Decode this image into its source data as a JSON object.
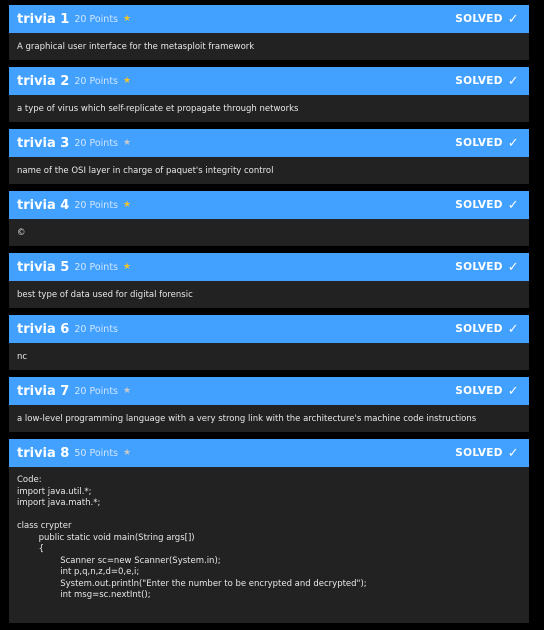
{
  "solved_label": "SOLVED",
  "colors": {
    "header": "#42a1ff",
    "body": "#222222",
    "star_gold": "#f2c230",
    "star_grey": "#c8c8c8"
  },
  "challenges": [
    {
      "title": "trivia 1",
      "points": "20 Points",
      "star": "gold",
      "description": "A graphical user interface for the metasploit framework"
    },
    {
      "title": "trivia 2",
      "points": "20 Points",
      "star": "gold",
      "description": "a type of virus which self-replicate et propagate through networks"
    },
    {
      "title": "trivia 3",
      "points": "20 Points",
      "star": "grey",
      "description": "name of the OSI layer in charge of paquet's integrity control"
    },
    {
      "title": "trivia 4",
      "points": "20 Points",
      "star": "gold",
      "description": "©"
    },
    {
      "title": "trivia 5",
      "points": "20 Points",
      "star": "gold",
      "description": "best type of data used for digital forensic"
    },
    {
      "title": "trivia 6",
      "points": "20 Points",
      "star": "none",
      "description": "nc"
    },
    {
      "title": "trivia 7",
      "points": "20 Points",
      "star": "grey",
      "description": "a low-level programming language with a very strong link with the architecture's machine code instructions"
    },
    {
      "title": "trivia 8",
      "points": "50 Points",
      "star": "grey",
      "description": "Code:\nimport java.util.*;\nimport java.math.*;\n\nclass crypter\n\tpublic static void main(String args[])\n\t{\n\t\tScanner sc=new Scanner(System.in);\n\t\tint p,q,n,z,d=0,e,i;\n\t\tSystem.out.println(\"Enter the number to be encrypted and decrypted\");\n\t\tint msg=sc.nextInt();"
    }
  ]
}
